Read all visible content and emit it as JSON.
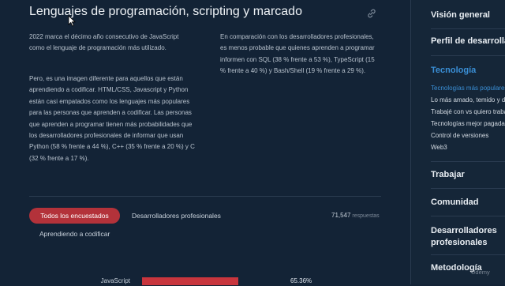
{
  "header": {
    "title": "Lenguajes de programación, scripting y marcado"
  },
  "content": {
    "paragraph_1": "2022 marca el décimo año consecutivo de JavaScript como el lenguaje de programación más utilizado.",
    "paragraph_2": "Pero, es una imagen diferente para aquellos que están aprendiendo a codificar. HTML/CSS, Javascript y Python están casi empatados como los lenguajes más populares para las personas que aprenden a codificar. Las personas que aprenden a programar tienen más probabilidades que los desarrolladores profesionales de informar que usan Python (58 % frente a 44 %), C++ (35 % frente a 20 %) y C (32 % frente a 17 %).",
    "paragraph_3": "En comparación con los desarrolladores profesionales, es menos probable que quienes aprenden a programar informen con SQL (38 % frente a 53 %), TypeScript (15 % frente a 40 %) y Bash/Shell (19 % frente a 29 %)."
  },
  "filters": {
    "all_label": "Todos los encuestados",
    "pro_label": "Desarrolladores profesionales",
    "learn_label": "Aprendiendo a codificar",
    "responses_count": "71,547",
    "responses_label": "respuestas"
  },
  "results": [
    {
      "label": "JavaScript",
      "value_text": "65.36%",
      "fraction": 0.6536
    }
  ],
  "sidebar": {
    "sections": {
      "overview": "Visión general",
      "profile": "Perfil de desarrollador",
      "tech": "Tecnología",
      "work": "Trabajar",
      "community": "Comunidad",
      "pro_devs": "Desarrolladores profesionales",
      "methodology": "Metodología"
    },
    "tech_items": [
      "Tecnologías más populares",
      "Lo más amado, temido y deseado",
      "Trabajé con vs quiero trabajar con",
      "Tecnologías mejor pagadas",
      "Control de versiones",
      "Web3"
    ]
  },
  "watermark": "Udemy",
  "colors": {
    "background": "#132336",
    "accent_red": "#c8353d",
    "active_blue": "#3a8fd6"
  }
}
